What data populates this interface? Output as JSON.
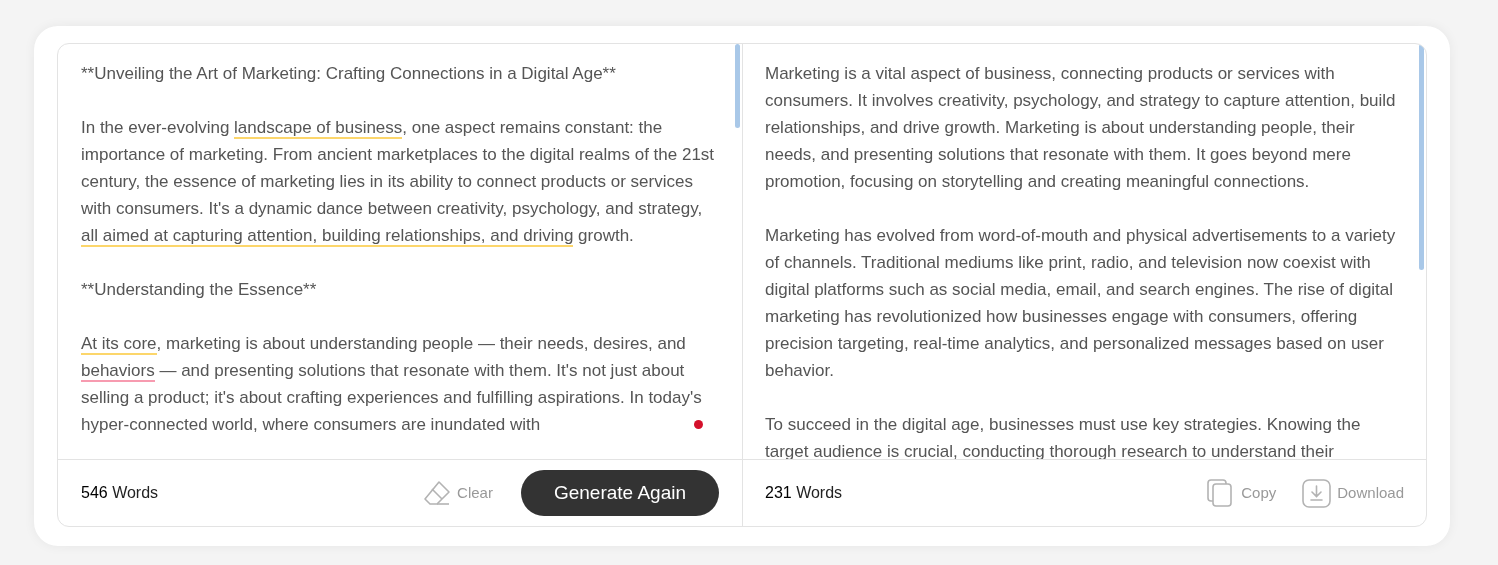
{
  "input_panel": {
    "paragraphs": [
      {
        "segments": [
          {
            "text": "**Unveiling the Art of Marketing: Crafting Connections in a Digital Age**",
            "kind": "plain"
          }
        ]
      },
      {
        "segments": [
          {
            "text": "In the ever-evolving ",
            "kind": "plain"
          },
          {
            "text": "landscape of business",
            "kind": "suggestion"
          },
          {
            "text": ", one aspect remains constant: the importance of marketing. From ancient marketplaces to the digital realms of the 21st century, the essence of marketing lies in its ability to connect products or services with consumers. It's a dynamic dance between creativity, psychology, and strategy, ",
            "kind": "plain"
          },
          {
            "text": "all aimed at capturing attention, building relationships, and driving",
            "kind": "suggestion"
          },
          {
            "text": " growth.",
            "kind": "plain"
          }
        ]
      },
      {
        "segments": [
          {
            "text": "**Understanding the Essence**",
            "kind": "plain"
          }
        ]
      },
      {
        "segments": [
          {
            "text": "At its core",
            "kind": "suggestion"
          },
          {
            "text": ", marketing is about understanding people — their needs, desires, and ",
            "kind": "plain"
          },
          {
            "text": "behaviors",
            "kind": "error"
          },
          {
            "text": " — and presenting solutions that resonate with them. It's not just about selling a product; it's about crafting experiences and fulfilling aspirations. In today's hyper-connected world, where consumers are inundated with",
            "kind": "plain"
          }
        ]
      }
    ],
    "word_count": "546",
    "word_label": "Words",
    "clear_label": "Clear",
    "generate_label": "Generate Again"
  },
  "output_panel": {
    "paragraphs": [
      "Marketing is a vital aspect of business, connecting products or services with consumers. It involves creativity, psychology, and strategy to capture attention, build relationships, and drive growth. Marketing is about understanding people, their needs, and presenting solutions that resonate with them. It goes beyond mere promotion, focusing on storytelling and creating meaningful connections.",
      "Marketing has evolved from word-of-mouth and physical advertisements to a variety of channels. Traditional mediums like print, radio, and television now coexist with digital platforms such as social media, email, and search engines. The rise of digital marketing has revolutionized how businesses engage with consumers, offering precision targeting, real-time analytics, and personalized messages based on user behavior.",
      "To succeed in the digital age, businesses must use key strategies. Knowing the target audience is crucial, conducting thorough research to understand their"
    ],
    "word_count": "231",
    "word_label": "Words",
    "copy_label": "Copy",
    "download_label": "Download"
  }
}
